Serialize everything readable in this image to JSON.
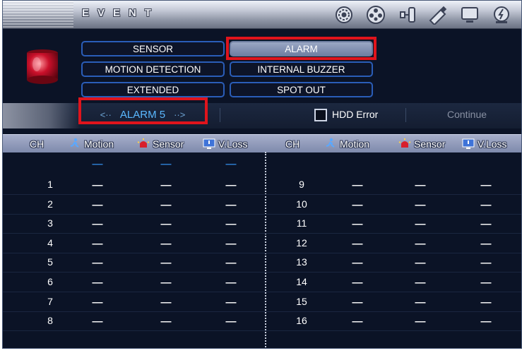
{
  "header": {
    "title": "EVENT"
  },
  "toolbar": {
    "icons": [
      "settings-gear-icon",
      "film-reel-icon",
      "network-icon",
      "usb-key-icon",
      "monitor-icon",
      "power-icon"
    ]
  },
  "menu": {
    "items": [
      {
        "label": "SENSOR"
      },
      {
        "label": "ALARM",
        "selected": true
      },
      {
        "label": "MOTION DETECTION"
      },
      {
        "label": "INTERNAL BUZZER"
      },
      {
        "label": "EXTENDED"
      },
      {
        "label": "SPOT OUT"
      }
    ]
  },
  "selector": {
    "current": "ALARM 5",
    "prev_arrow": "<··",
    "next_arrow": "··>"
  },
  "hdd_error": {
    "label": "HDD Error",
    "checked": false
  },
  "action": {
    "continue_label": "Continue"
  },
  "table": {
    "headers": [
      "CH",
      "Motion",
      "Sensor",
      "V.Loss"
    ],
    "all_row": {
      "motion": "-----",
      "sensor": "-----",
      "vloss": "-----"
    },
    "left": [
      {
        "ch": "1",
        "motion": "-----",
        "sensor": "-----",
        "vloss": "-----"
      },
      {
        "ch": "2",
        "motion": "-----",
        "sensor": "-----",
        "vloss": "-----"
      },
      {
        "ch": "3",
        "motion": "-----",
        "sensor": "-----",
        "vloss": "-----"
      },
      {
        "ch": "4",
        "motion": "-----",
        "sensor": "-----",
        "vloss": "-----"
      },
      {
        "ch": "5",
        "motion": "-----",
        "sensor": "-----",
        "vloss": "-----"
      },
      {
        "ch": "6",
        "motion": "-----",
        "sensor": "-----",
        "vloss": "-----"
      },
      {
        "ch": "7",
        "motion": "-----",
        "sensor": "-----",
        "vloss": "-----"
      },
      {
        "ch": "8",
        "motion": "-----",
        "sensor": "-----",
        "vloss": "-----"
      }
    ],
    "right": [
      {
        "ch": "9",
        "motion": "-----",
        "sensor": "-----",
        "vloss": "-----"
      },
      {
        "ch": "10",
        "motion": "-----",
        "sensor": "-----",
        "vloss": "-----"
      },
      {
        "ch": "11",
        "motion": "-----",
        "sensor": "-----",
        "vloss": "-----"
      },
      {
        "ch": "12",
        "motion": "-----",
        "sensor": "-----",
        "vloss": "-----"
      },
      {
        "ch": "13",
        "motion": "-----",
        "sensor": "-----",
        "vloss": "-----"
      },
      {
        "ch": "14",
        "motion": "-----",
        "sensor": "-----",
        "vloss": "-----"
      },
      {
        "ch": "15",
        "motion": "-----",
        "sensor": "-----",
        "vloss": "-----"
      },
      {
        "ch": "16",
        "motion": "-----",
        "sensor": "-----",
        "vloss": "-----"
      }
    ]
  },
  "colors": {
    "background": "#0b1326",
    "highlight": "#e0141c",
    "accent": "#5ab8ff",
    "button_border": "#2a5db8"
  }
}
